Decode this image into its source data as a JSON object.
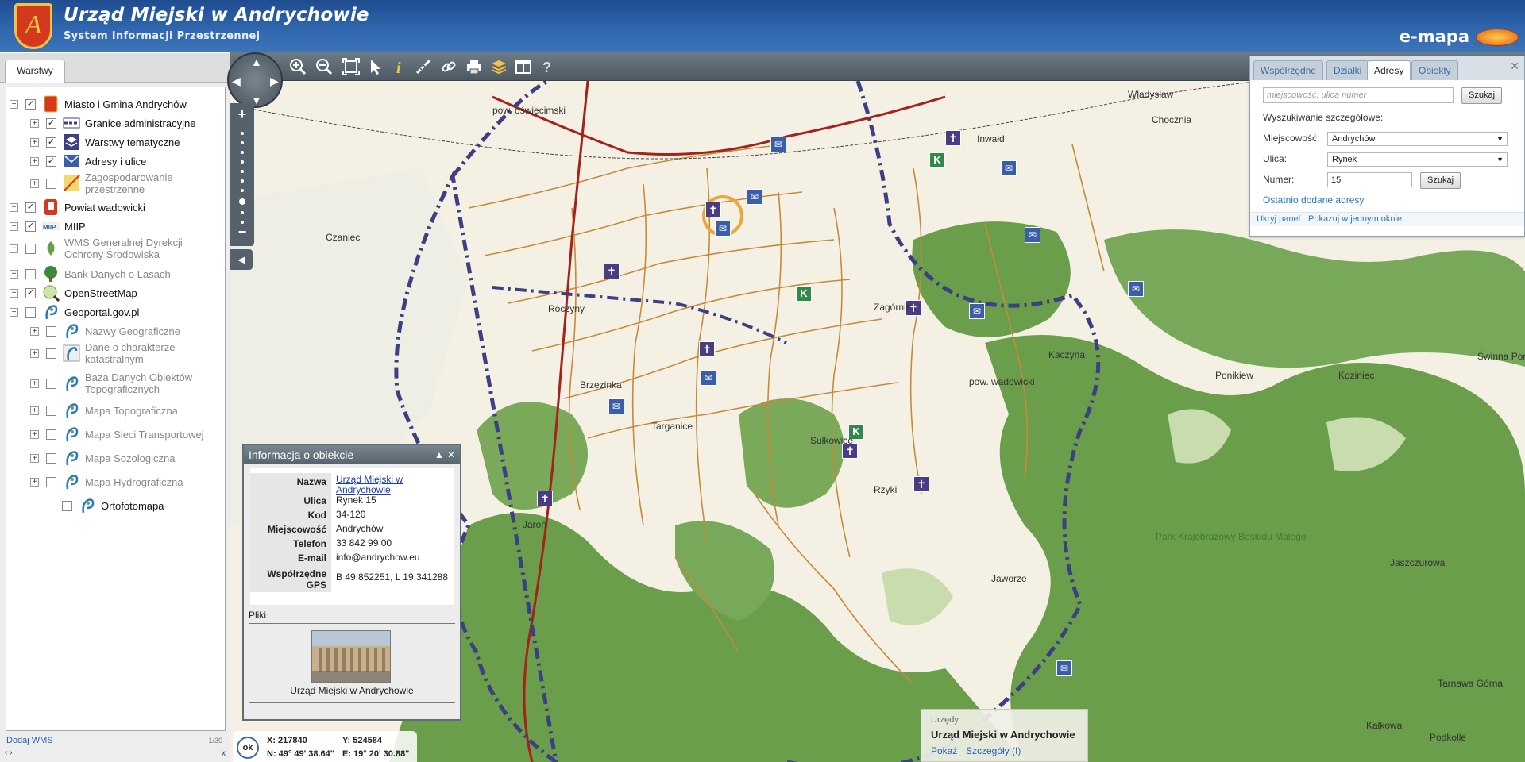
{
  "header": {
    "title": "Urząd Miejski w Andrychowie",
    "subtitle": "System Informacji Przestrzennej",
    "brand": "e-mapa"
  },
  "sidebar": {
    "tab": "Warstwy",
    "layers": [
      {
        "label": "Miasto i Gmina Andrychów",
        "checked": true,
        "expander": "−"
      },
      {
        "label": "Granice administracyjne",
        "checked": true,
        "expander": "+"
      },
      {
        "label": "Warstwy tematyczne",
        "checked": true,
        "expander": "+"
      },
      {
        "label": "Adresy i ulice",
        "checked": true,
        "expander": "+"
      },
      {
        "label": "Zagospodarowanie przestrzenne",
        "checked": false,
        "expander": "+"
      },
      {
        "label": "Powiat wadowicki",
        "checked": true,
        "expander": "+"
      },
      {
        "label": "MIIP",
        "checked": true,
        "expander": "+"
      },
      {
        "label": "WMS Generalnej Dyrekcji Ochrony Środowiska",
        "checked": false,
        "expander": "+"
      },
      {
        "label": "Bank Danych o Lasach",
        "checked": false,
        "expander": "+"
      },
      {
        "label": "OpenStreetMap",
        "checked": true,
        "expander": "+"
      },
      {
        "label": "Geoportal.gov.pl",
        "checked": false,
        "expander": "−"
      },
      {
        "label": "Nazwy Geograficzne",
        "checked": false,
        "expander": "+"
      },
      {
        "label": "Dane o charakterze katastralnym",
        "checked": false,
        "expander": "+"
      },
      {
        "label": "Baza Danych Obiektów Topograficznych",
        "checked": false,
        "expander": "+"
      },
      {
        "label": "Mapa Topograficzna",
        "checked": false,
        "expander": "+"
      },
      {
        "label": "Mapa Sieci Transportowej",
        "checked": false,
        "expander": "+"
      },
      {
        "label": "Mapa Sozologiczna",
        "checked": false,
        "expander": "+"
      },
      {
        "label": "Mapa Hydrograficzna",
        "checked": false,
        "expander": "+"
      },
      {
        "label": "Ortofotomapa",
        "checked": false,
        "expander": ""
      }
    ],
    "add_wms": "Dodaj WMS",
    "scale_note": "1/30",
    "nav": "‹ ›",
    "close": "x"
  },
  "toolbar": {
    "icons": [
      "zoom-in-icon",
      "zoom-out-icon",
      "zoom-extent-icon",
      "select-arrow-icon",
      "info-icon",
      "measure-icon",
      "link-icon",
      "print-icon",
      "layers-icon",
      "layout-icon",
      "help-icon"
    ]
  },
  "map_controls": {
    "zoom_in": "+",
    "zoom_out": "−",
    "collapse": "◀"
  },
  "map_labels": [
    {
      "text": "pow. oświęcimski",
      "style": "normal"
    },
    {
      "text": "Czaniec",
      "style": "normal"
    },
    {
      "text": "Roczyny",
      "style": "normal"
    },
    {
      "text": "Brzezinka",
      "style": "normal"
    },
    {
      "text": "Targanice",
      "style": "normal"
    },
    {
      "text": "Sułkowice",
      "style": "normal"
    },
    {
      "text": "Zagórnik",
      "style": "normal"
    },
    {
      "text": "Chocznia",
      "style": "normal"
    },
    {
      "text": "Inwałd",
      "style": "normal"
    },
    {
      "text": "Kaczyna",
      "style": "normal"
    },
    {
      "text": "Ponikiew",
      "style": "normal"
    },
    {
      "text": "Koziniec",
      "style": "normal"
    },
    {
      "text": "Świnna Poręba",
      "style": "normal"
    },
    {
      "text": "pow. wadowicki",
      "style": "normal"
    },
    {
      "text": "Park Krajobrazowy Beskidu Małego",
      "style": "green"
    },
    {
      "text": "Jaszczurowa",
      "style": "normal"
    },
    {
      "text": "Tarnawa Górna",
      "style": "normal"
    },
    {
      "text": "Kałkowa",
      "style": "normal"
    },
    {
      "text": "Podkolle",
      "style": "normal"
    },
    {
      "text": "Władysław",
      "style": "normal"
    },
    {
      "text": "Rzyki",
      "style": "normal"
    },
    {
      "text": "Jaroń",
      "style": "normal"
    },
    {
      "text": "Jaworze",
      "style": "normal"
    }
  ],
  "search_panel": {
    "tabs": [
      "Współrzędne",
      "Działki",
      "Adresy",
      "Obiekty"
    ],
    "active_tab": "Adresy",
    "quick_placeholder": "miejscowość, ulica numer",
    "search_button": "Szukaj",
    "detailed_heading": "Wyszukiwanie szczegółowe:",
    "town_label": "Miejscowość:",
    "town_value": "Andrychów",
    "street_label": "Ulica:",
    "street_value": "Rynek",
    "number_label": "Numer:",
    "number_value": "15",
    "recent_link": "Ostatnio dodane adresy",
    "hide_panel": "Ukryj panel",
    "show_one_window": "Pokazuj w jednym oknie",
    "close": "✕"
  },
  "info_popup": {
    "title": "Informacja o obiekcie",
    "rows": [
      {
        "key": "Nazwa",
        "value": "Urząd Miejski w Andrychowie",
        "link": true
      },
      {
        "key": "Ulica",
        "value": "Rynek 15",
        "link": false
      },
      {
        "key": "Kod",
        "value": "34-120",
        "link": false
      },
      {
        "key": "Miejscowość",
        "value": "Andrychów",
        "link": false
      },
      {
        "key": "Telefon",
        "value": "33 842 99 00",
        "link": false
      },
      {
        "key": "E-mail",
        "value": "info@andrychow.eu",
        "link": false
      },
      {
        "key": "Współrzędne GPS",
        "value": "B 49.852251, L 19.341288",
        "link": false
      }
    ],
    "files_label": "Pliki",
    "photo_caption": "Urząd Miejski w Andrychowie"
  },
  "coords": {
    "ok": "ok",
    "x": "X: 217840",
    "y": "Y: 524584",
    "n": "N: 49° 49' 38.64\"",
    "e": "E: 19° 20' 30.88\""
  },
  "tooltip": {
    "category": "Urzędy",
    "name": "Urząd Miejski w Andrychowie",
    "show": "Pokaż",
    "details": "Szczegóły (I)"
  },
  "colors": {
    "header": "#2f66ad",
    "forest": "#6a9e4a",
    "boundary": "#3c3f84",
    "main_road": "#a4221a",
    "road": "#c68a3a"
  }
}
